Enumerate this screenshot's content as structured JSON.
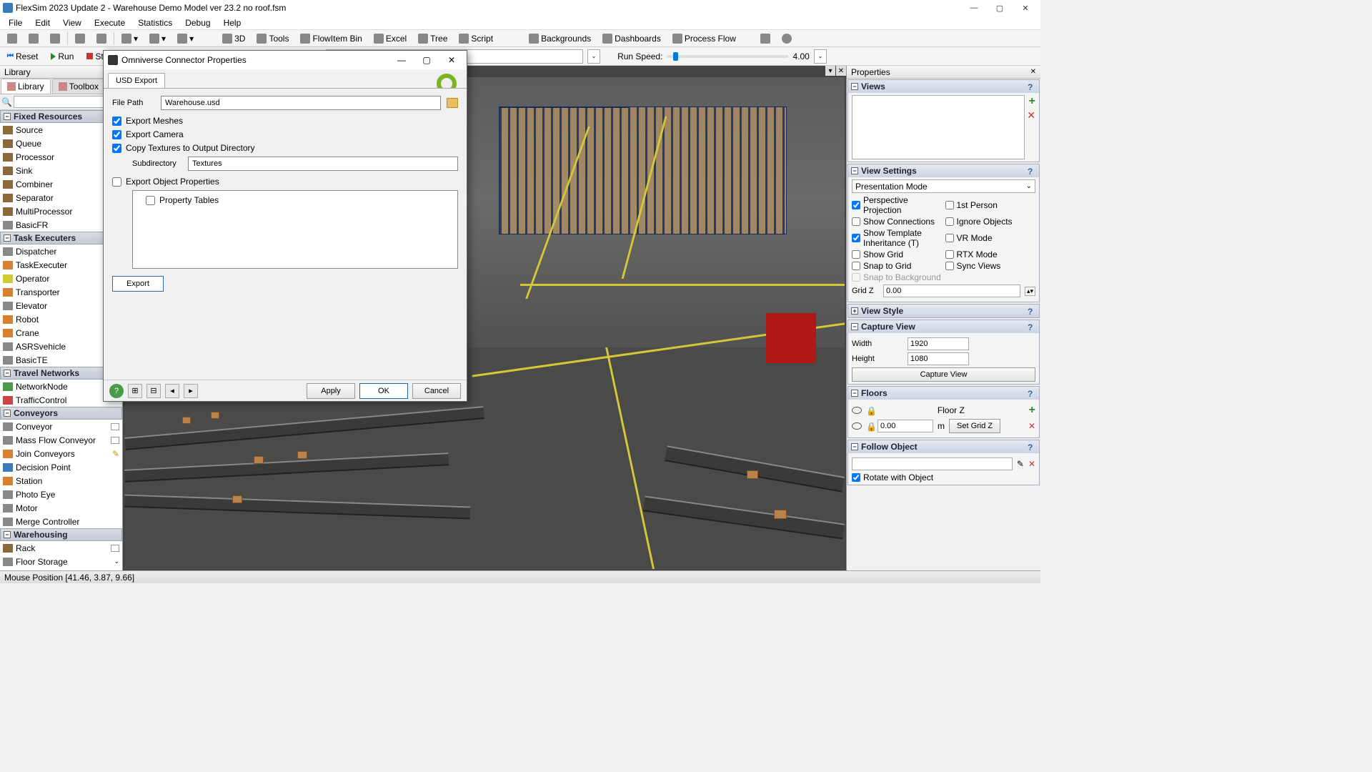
{
  "app": {
    "title": "FlexSim 2023 Update 2 - Warehouse Demo Model ver 23.2 no roof.fsm"
  },
  "menu": [
    "File",
    "Edit",
    "View",
    "Execute",
    "Statistics",
    "Debug",
    "Help"
  ],
  "toolbar": {
    "items": [
      "3D",
      "Tools",
      "FlowItem Bin",
      "Excel",
      "Tree",
      "Script",
      "Backgrounds",
      "Dashboards",
      "Process Flow"
    ]
  },
  "run": {
    "reset": "Reset",
    "run": "Run",
    "stop": "Stop",
    "speed_label": "Run Speed:",
    "speed_value": "4.00"
  },
  "library": {
    "title": "Library",
    "tabs": {
      "library": "Library",
      "toolbox": "Toolbox"
    },
    "categories": [
      {
        "name": "Fixed Resources",
        "items": [
          "Source",
          "Queue",
          "Processor",
          "Sink",
          "Combiner",
          "Separator",
          "MultiProcessor",
          "BasicFR"
        ]
      },
      {
        "name": "Task Executers",
        "items": [
          "Dispatcher",
          "TaskExecuter",
          "Operator",
          "Transporter",
          "Elevator",
          "Robot",
          "Crane",
          "ASRSvehicle",
          "BasicTE"
        ]
      },
      {
        "name": "Travel Networks",
        "items": [
          "NetworkNode",
          "TrafficControl"
        ]
      },
      {
        "name": "Conveyors",
        "items": [
          "Conveyor",
          "Mass Flow Conveyor",
          "Join Conveyors",
          "Decision Point",
          "Station",
          "Photo Eye",
          "Motor",
          "Merge Controller"
        ]
      },
      {
        "name": "Warehousing",
        "items": [
          "Rack",
          "Floor Storage"
        ]
      }
    ]
  },
  "properties": {
    "title": "Properties",
    "views": "Views",
    "view_settings": {
      "title": "View Settings",
      "mode": "Presentation Mode",
      "checks": {
        "perspective": "Perspective Projection",
        "first_person": "1st Person",
        "show_conn": "Show Connections",
        "ignore_obj": "Ignore Objects",
        "show_tmpl": "Show Template Inheritance (T)",
        "vr": "VR Mode",
        "show_grid": "Show Grid",
        "rtx": "RTX Mode",
        "snap_grid": "Snap to Grid",
        "sync": "Sync Views",
        "snap_bg": "Snap to Background"
      },
      "gridz_label": "Grid Z",
      "gridz": "0.00"
    },
    "view_style": "View Style",
    "capture": {
      "title": "Capture View",
      "width_l": "Width",
      "width": "1920",
      "height_l": "Height",
      "height": "1080",
      "button": "Capture View"
    },
    "floors": {
      "title": "Floors",
      "floorz": "Floor Z",
      "z": "0.00",
      "unit": "m",
      "setgrid": "Set Grid Z"
    },
    "follow": {
      "title": "Follow Object",
      "rotate": "Rotate with Object"
    }
  },
  "status": "Mouse Position [41.46, 3.87, 9.66]",
  "dialog": {
    "title": "Omniverse Connector Properties",
    "tab": "USD Export",
    "filepath_l": "File Path",
    "filepath": "Warehouse.usd",
    "export_meshes": "Export Meshes",
    "export_camera": "Export Camera",
    "copy_textures": "Copy Textures to Output Directory",
    "subdir_l": "Subdirectory",
    "subdir": "Textures",
    "export_objprops": "Export Object Properties",
    "prop_tables": "Property Tables",
    "export_btn": "Export",
    "apply": "Apply",
    "ok": "OK",
    "cancel": "Cancel"
  }
}
